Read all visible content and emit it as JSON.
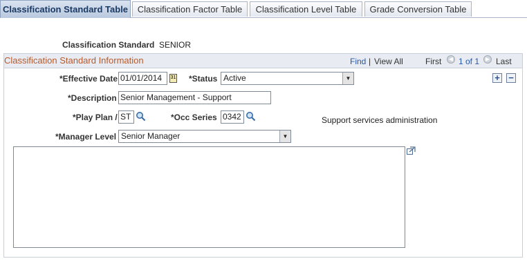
{
  "tabs": [
    {
      "label": "Classification Standard Table",
      "active": true
    },
    {
      "label": "Classification Factor Table",
      "active": false
    },
    {
      "label": "Classification Level Table",
      "active": false
    },
    {
      "label": "Grade Conversion Table",
      "active": false
    }
  ],
  "header": {
    "standard_label": "Classification Standard",
    "standard_value": "SENIOR"
  },
  "group": {
    "title": "Classification Standard Information",
    "find": "Find",
    "view_all": "View All",
    "first": "First",
    "count": "1 of 1",
    "last": "Last"
  },
  "form": {
    "effective_date_label": "*Effective Date",
    "effective_date_value": "01/01/2014",
    "status_label": "*Status",
    "status_value": "Active",
    "description_label": "*Description",
    "description_value": "Senior Management - Support",
    "play_plan_label": "*Play Plan /",
    "play_plan_value": "ST",
    "occ_series_label": "*Occ Series",
    "occ_series_value": "0342",
    "occ_series_desc": "Support services administration",
    "manager_level_label": "*Manager Level",
    "manager_level_value": "Senior Manager"
  },
  "icons": {
    "add": "+",
    "delete": "−",
    "nav_prev": "◀",
    "nav_next": "▶",
    "dropdown": "▼"
  }
}
